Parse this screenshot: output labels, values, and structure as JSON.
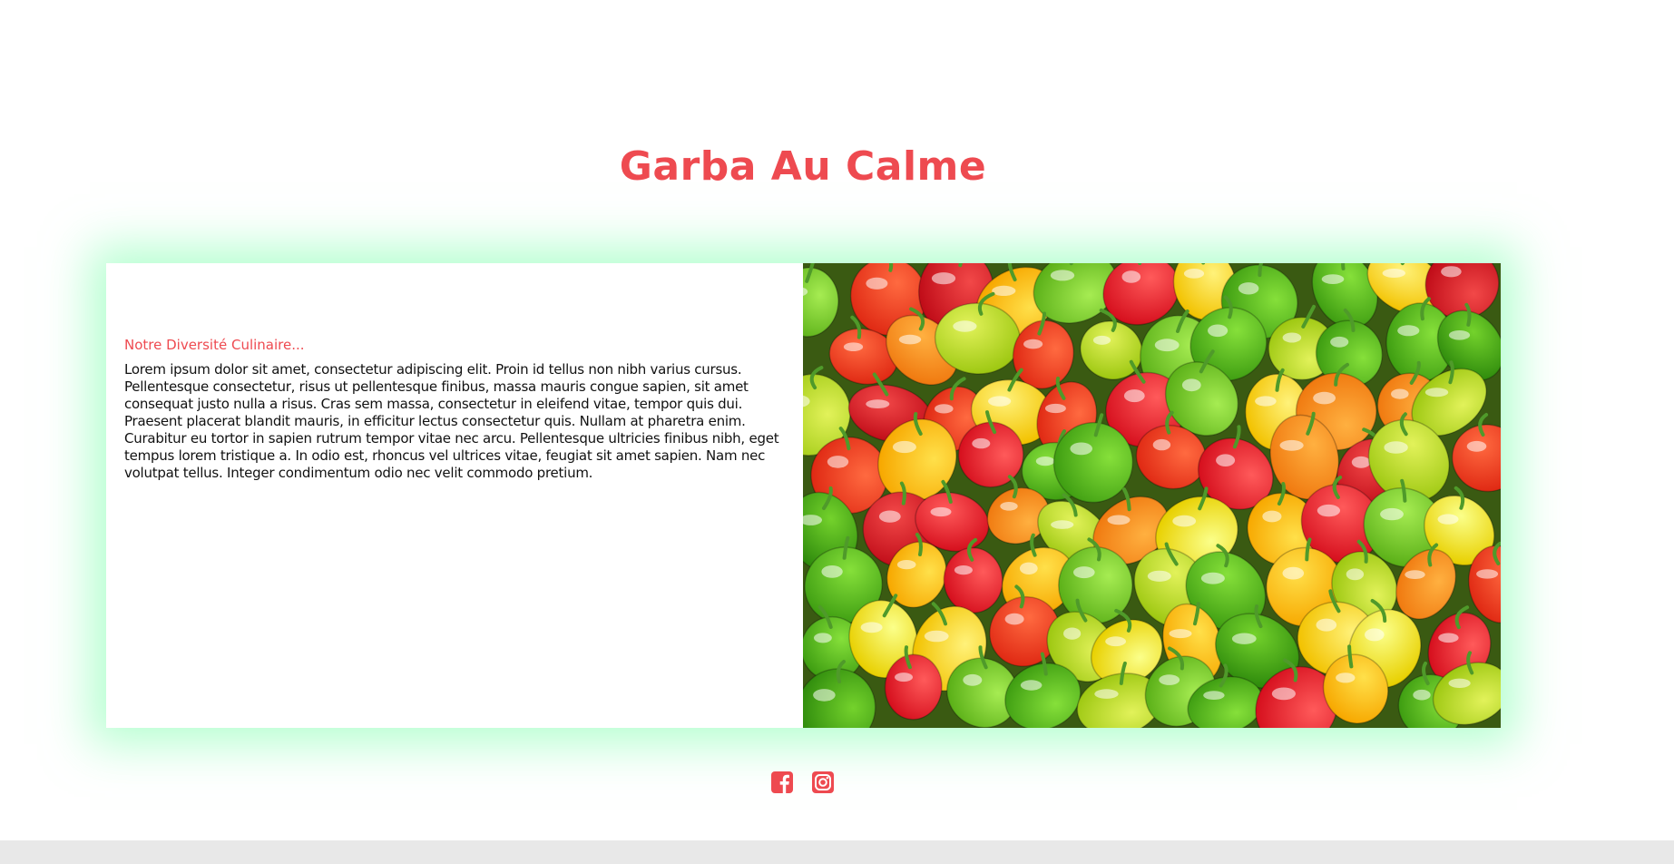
{
  "header": {
    "title": "Garba Au Calme"
  },
  "feature": {
    "heading": "Notre Diversité Culinaire...",
    "body": "Lorem ipsum dolor sit amet, consectetur adipiscing elit. Proin id tellus non nibh varius cursus. Pellentesque consectetur, risus ut pellentesque finibus, massa mauris congue sapien, sit amet consequat justo nulla a risus. Cras sem massa, consectetur in eleifend vitae, tempor quis dui. Praesent placerat blandit mauris, in efficitur lectus consectetur quis. Nullam at pharetra enim. Curabitur eu tortor in sapien rutrum tempor vitae nec arcu. Pellentesque ultricies finibus nibh, eget tempus lorem tristique a. In odio est, rhoncus vel ultrices vitae, feugiat sit amet sapien. Nam nec volutpat tellus. Integer condimentum odio nec velit commodo pretium.",
    "image": {
      "icon": "peppers-photo"
    }
  },
  "social": {
    "items": [
      {
        "icon": "facebook-icon"
      },
      {
        "icon": "instagram-icon"
      }
    ]
  },
  "colors": {
    "accent": "#ee4a50",
    "card_glow": "#78ffaa",
    "footer": "#e8e8e8",
    "text": "#111111"
  }
}
